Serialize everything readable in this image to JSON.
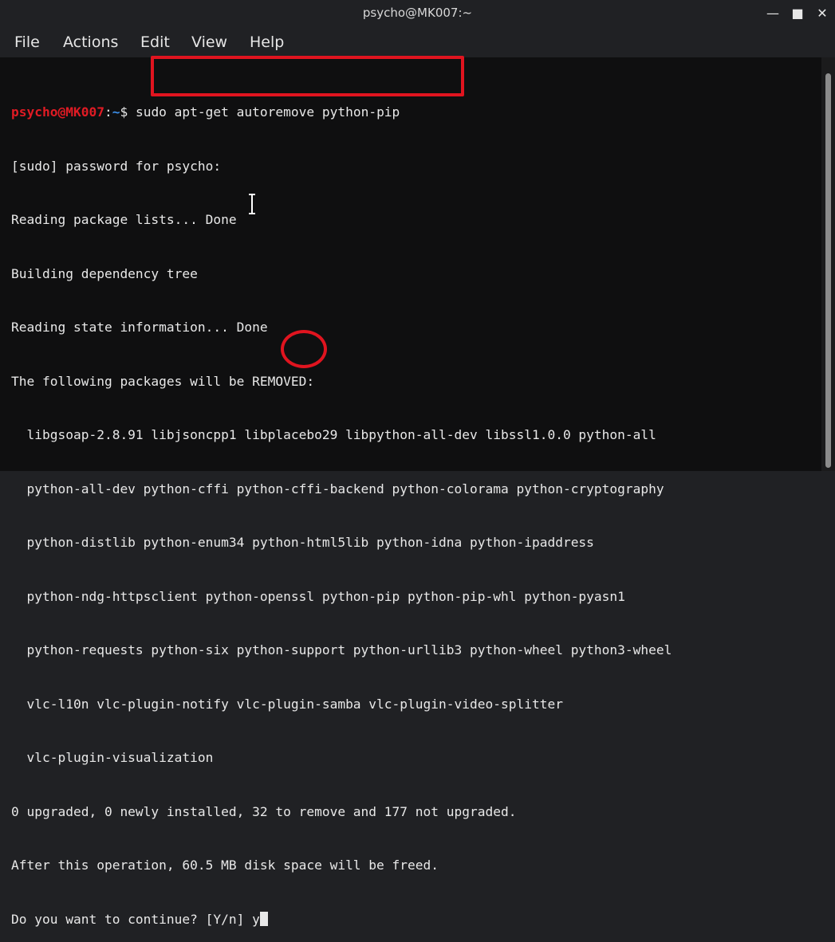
{
  "window": {
    "title": "psycho@MK007:~",
    "minimize_glyph": "—",
    "maximize_glyph": "■",
    "close_glyph": "✕"
  },
  "menu": {
    "file": "File",
    "actions": "Actions",
    "edit": "Edit",
    "view": "View",
    "help": "Help"
  },
  "prompt": {
    "user_host": "psycho@MK007",
    "separator": ":",
    "path": "~",
    "symbol": "$",
    "command": " sudo apt-get autoremove python-pip"
  },
  "output_lines": [
    "[sudo] password for psycho:",
    "Reading package lists... Done",
    "Building dependency tree",
    "Reading state information... Done",
    "The following packages will be REMOVED:",
    "  libgsoap-2.8.91 libjsoncpp1 libplacebo29 libpython-all-dev libssl1.0.0 python-all",
    "  python-all-dev python-cffi python-cffi-backend python-colorama python-cryptography",
    "  python-distlib python-enum34 python-html5lib python-idna python-ipaddress",
    "  python-ndg-httpsclient python-openssl python-pip python-pip-whl python-pyasn1",
    "  python-requests python-six python-support python-urllib3 python-wheel python3-wheel",
    "  vlc-l10n vlc-plugin-notify vlc-plugin-samba vlc-plugin-video-splitter",
    "  vlc-plugin-visualization",
    "0 upgraded, 0 newly installed, 32 to remove and 177 not upgraded.",
    "After this operation, 60.5 MB disk space will be freed."
  ],
  "confirm": {
    "question": "Do you want to continue? [Y/n] ",
    "answer": "y"
  },
  "colors": {
    "prompt_user": "#e01b24",
    "prompt_path": "#3b8ee8",
    "annotation": "#e0141f"
  }
}
